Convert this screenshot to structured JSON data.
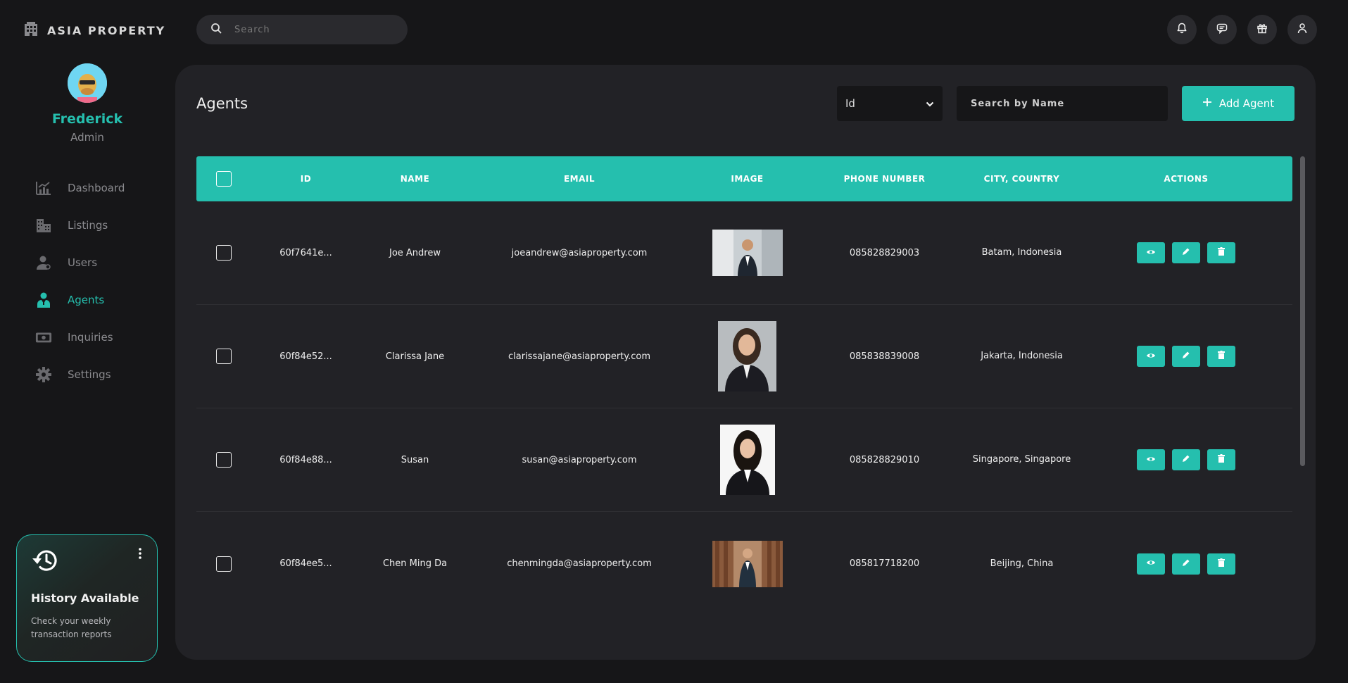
{
  "app": {
    "brand": "ASIA PROPERTY"
  },
  "topbar": {
    "search_placeholder": "Search"
  },
  "user": {
    "name": "Frederick",
    "role": "Admin"
  },
  "sidebar": {
    "items": [
      {
        "label": "Dashboard",
        "icon": "chart-icon",
        "active": false
      },
      {
        "label": "Listings",
        "icon": "buildings-icon",
        "active": false
      },
      {
        "label": "Users",
        "icon": "user-icon",
        "active": false
      },
      {
        "label": "Agents",
        "icon": "agent-icon",
        "active": true
      },
      {
        "label": "Inquiries",
        "icon": "money-icon",
        "active": false
      },
      {
        "label": "Settings",
        "icon": "gear-icon",
        "active": false
      }
    ]
  },
  "history_card": {
    "title": "History Available",
    "description": "Check your weekly transaction reports"
  },
  "main": {
    "title": "Agents",
    "filter_select": "Id",
    "name_search_placeholder": "Search by Name",
    "add_label": "Add Agent",
    "columns": [
      "ID",
      "NAME",
      "EMAIL",
      "IMAGE",
      "PHONE NUMBER",
      "CITY, COUNTRY",
      "ACTIONS"
    ],
    "rows": [
      {
        "id": "60f7641e...",
        "name": "Joe Andrew",
        "email": "joeandrew@asiaproperty.com",
        "phone": "085828829003",
        "city": "Batam, Indonesia"
      },
      {
        "id": "60f84e52...",
        "name": "Clarissa Jane",
        "email": "clarissajane@asiaproperty.com",
        "phone": "085838839008",
        "city": "Jakarta, Indonesia"
      },
      {
        "id": "60f84e88...",
        "name": "Susan",
        "email": "susan@asiaproperty.com",
        "phone": "085828829010",
        "city": "Singapore, Singapore"
      },
      {
        "id": "60f84ee5...",
        "name": "Chen Ming Da",
        "email": "chenmingda@asiaproperty.com",
        "phone": "085817718200",
        "city": "Beijing, China"
      }
    ]
  },
  "colors": {
    "accent": "#25bfae",
    "background": "#161618",
    "panel": "#222226"
  }
}
